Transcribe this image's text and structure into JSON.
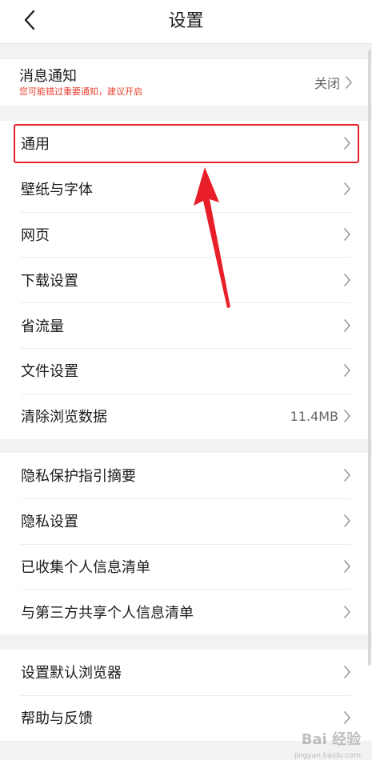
{
  "header": {
    "title": "设置"
  },
  "notification": {
    "title": "消息通知",
    "subtitle": "您可能错过重要通知，建议开启",
    "value": "关闭"
  },
  "group1": [
    {
      "label": "通用",
      "value": ""
    },
    {
      "label": "壁纸与字体",
      "value": ""
    },
    {
      "label": "网页",
      "value": ""
    },
    {
      "label": "下载设置",
      "value": ""
    },
    {
      "label": "省流量",
      "value": ""
    },
    {
      "label": "文件设置",
      "value": ""
    },
    {
      "label": "清除浏览数据",
      "value": "11.4MB"
    }
  ],
  "group2": [
    {
      "label": "隐私保护指引摘要"
    },
    {
      "label": "隐私设置"
    },
    {
      "label": "已收集个人信息清单"
    },
    {
      "label": "与第三方共享个人信息清单"
    }
  ],
  "group3": [
    {
      "label": "设置默认浏览器"
    },
    {
      "label": "帮助与反馈"
    }
  ],
  "watermark": {
    "text": "Bai 经验",
    "sub": "jingyan.baidu.com"
  },
  "colors": {
    "highlight": "#e81e28",
    "notice_text": "#e8402f"
  }
}
